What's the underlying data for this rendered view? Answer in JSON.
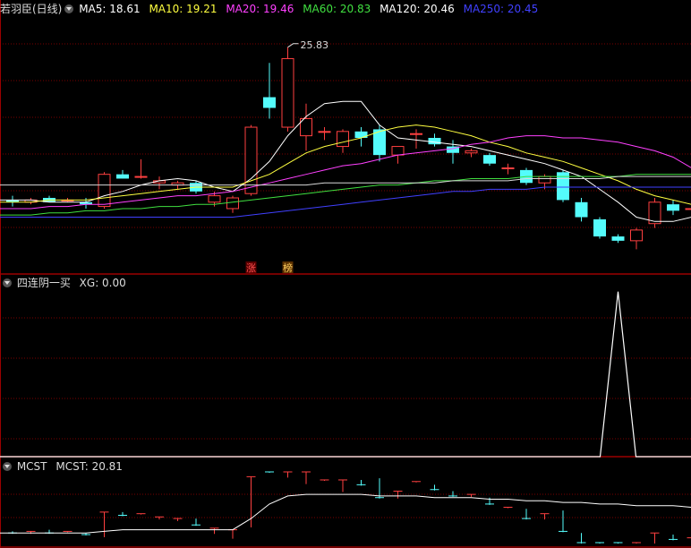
{
  "panel1": {
    "title": "若羽臣(日线)",
    "ma": [
      {
        "label": "MA5: 18.61",
        "color": "#ffffff"
      },
      {
        "label": "MA10: 19.21",
        "color": "#ffff40"
      },
      {
        "label": "MA20: 19.46",
        "color": "#ff40ff"
      },
      {
        "label": "MA60: 20.83",
        "color": "#40e040"
      },
      {
        "label": "MA120: 20.46",
        "color": "#ffffff"
      },
      {
        "label": "MA250: 20.45",
        "color": "#4040ff"
      }
    ],
    "peak_label": "25.83",
    "markers": [
      "涨",
      "榜"
    ]
  },
  "panel2": {
    "title": "四连阴一买",
    "legend": "XG: 0.00"
  },
  "panel3": {
    "title": "MCST",
    "legend": "MCST: 20.81"
  },
  "colors": {
    "up": "#ff4040",
    "down": "#54fcfc",
    "grid": "#7a0000",
    "border": "#9b0000"
  },
  "chart_data": {
    "type": "candlestick",
    "price_range": [
      16.0,
      27.2
    ],
    "candles": [
      {
        "o": 18.7,
        "h": 18.9,
        "l": 18.4,
        "c": 18.6
      },
      {
        "o": 18.6,
        "h": 18.8,
        "l": 18.5,
        "c": 18.7
      },
      {
        "o": 18.8,
        "h": 18.9,
        "l": 18.6,
        "c": 18.6
      },
      {
        "o": 18.7,
        "h": 18.8,
        "l": 18.6,
        "c": 18.7
      },
      {
        "o": 18.6,
        "h": 18.8,
        "l": 18.3,
        "c": 18.5
      },
      {
        "o": 18.4,
        "h": 20.0,
        "l": 18.3,
        "c": 19.9
      },
      {
        "o": 19.9,
        "h": 20.1,
        "l": 19.7,
        "c": 19.7
      },
      {
        "o": 19.8,
        "h": 20.6,
        "l": 19.7,
        "c": 19.8
      },
      {
        "o": 19.5,
        "h": 19.8,
        "l": 19.2,
        "c": 19.6
      },
      {
        "o": 19.4,
        "h": 19.6,
        "l": 19.2,
        "c": 19.5
      },
      {
        "o": 19.5,
        "h": 19.6,
        "l": 19.0,
        "c": 19.1
      },
      {
        "o": 18.6,
        "h": 19.1,
        "l": 18.4,
        "c": 18.9
      },
      {
        "o": 18.3,
        "h": 18.9,
        "l": 18.1,
        "c": 18.8
      },
      {
        "o": 19.0,
        "h": 22.2,
        "l": 18.9,
        "c": 22.1
      },
      {
        "o": 23.5,
        "h": 25.1,
        "l": 22.5,
        "c": 23.0
      },
      {
        "o": 22.1,
        "h": 25.83,
        "l": 21.9,
        "c": 25.3
      },
      {
        "o": 21.7,
        "h": 23.2,
        "l": 21.0,
        "c": 22.5
      },
      {
        "o": 21.9,
        "h": 22.1,
        "l": 21.5,
        "c": 21.9
      },
      {
        "o": 21.2,
        "h": 22.0,
        "l": 20.9,
        "c": 21.9
      },
      {
        "o": 21.9,
        "h": 22.1,
        "l": 21.2,
        "c": 21.6
      },
      {
        "o": 22.0,
        "h": 22.2,
        "l": 20.5,
        "c": 20.8
      },
      {
        "o": 20.8,
        "h": 21.2,
        "l": 20.4,
        "c": 21.2
      },
      {
        "o": 21.8,
        "h": 22.0,
        "l": 21.1,
        "c": 21.8
      },
      {
        "o": 21.6,
        "h": 21.8,
        "l": 21.2,
        "c": 21.3
      },
      {
        "o": 21.2,
        "h": 21.5,
        "l": 20.4,
        "c": 20.9
      },
      {
        "o": 20.9,
        "h": 21.1,
        "l": 20.7,
        "c": 21.0
      },
      {
        "o": 20.8,
        "h": 20.9,
        "l": 20.3,
        "c": 20.4
      },
      {
        "o": 20.2,
        "h": 20.4,
        "l": 19.9,
        "c": 20.2
      },
      {
        "o": 20.1,
        "h": 20.2,
        "l": 19.4,
        "c": 19.5
      },
      {
        "o": 19.5,
        "h": 19.9,
        "l": 19.2,
        "c": 19.8
      },
      {
        "o": 20.0,
        "h": 20.1,
        "l": 18.6,
        "c": 18.7
      },
      {
        "o": 18.6,
        "h": 18.8,
        "l": 17.7,
        "c": 17.9
      },
      {
        "o": 17.8,
        "h": 17.9,
        "l": 16.9,
        "c": 17.0
      },
      {
        "o": 17.0,
        "h": 17.1,
        "l": 16.7,
        "c": 16.8
      },
      {
        "o": 16.8,
        "h": 17.4,
        "l": 16.4,
        "c": 17.3
      },
      {
        "o": 17.6,
        "h": 18.8,
        "l": 17.4,
        "c": 18.6
      },
      {
        "o": 18.5,
        "h": 18.7,
        "l": 18.0,
        "c": 18.2
      },
      {
        "o": 18.3,
        "h": 18.5,
        "l": 18.1,
        "c": 18.3
      },
      {
        "o": 18.4,
        "h": 18.8,
        "l": 18.2,
        "c": 18.7
      }
    ],
    "ma_series": [
      {
        "label_index": 0,
        "color": "#ffffff",
        "values": [
          18.7,
          18.7,
          18.6,
          18.6,
          18.6,
          18.9,
          19.1,
          19.4,
          19.6,
          19.7,
          19.6,
          19.3,
          19.1,
          19.7,
          20.5,
          21.7,
          22.6,
          23.2,
          23.3,
          23.3,
          22.2,
          21.6,
          21.5,
          21.4,
          21.3,
          21.2,
          21.0,
          20.8,
          20.6,
          20.4,
          20.1,
          19.8,
          19.2,
          18.6,
          17.9,
          17.7,
          17.7,
          17.9,
          18.4
        ]
      },
      {
        "label_index": 1,
        "color": "#ffff40",
        "values": [
          18.6,
          18.6,
          18.7,
          18.7,
          18.7,
          18.8,
          18.9,
          19.0,
          19.1,
          19.2,
          19.3,
          19.3,
          19.3,
          19.6,
          19.9,
          20.4,
          20.9,
          21.2,
          21.4,
          21.6,
          21.9,
          22.1,
          22.2,
          22.1,
          21.9,
          21.7,
          21.4,
          21.2,
          20.9,
          20.7,
          20.5,
          20.2,
          19.9,
          19.6,
          19.2,
          18.9,
          18.7,
          18.5,
          18.4
        ]
      },
      {
        "label_index": 2,
        "color": "#ff40ff",
        "values": [
          18.3,
          18.3,
          18.4,
          18.4,
          18.5,
          18.5,
          18.6,
          18.7,
          18.8,
          18.9,
          18.9,
          19.0,
          19.1,
          19.3,
          19.5,
          19.7,
          19.9,
          20.1,
          20.3,
          20.4,
          20.6,
          20.8,
          20.9,
          21.0,
          21.1,
          21.3,
          21.4,
          21.6,
          21.7,
          21.7,
          21.6,
          21.6,
          21.5,
          21.4,
          21.2,
          21.0,
          20.7,
          20.2,
          19.5
        ]
      },
      {
        "label_index": 3,
        "color": "#40e040",
        "values": [
          18.0,
          18.0,
          18.1,
          18.1,
          18.2,
          18.2,
          18.3,
          18.3,
          18.4,
          18.4,
          18.5,
          18.5,
          18.6,
          18.7,
          18.8,
          18.9,
          19.0,
          19.1,
          19.2,
          19.3,
          19.4,
          19.4,
          19.5,
          19.6,
          19.6,
          19.7,
          19.7,
          19.7,
          19.8,
          19.8,
          19.8,
          19.8,
          19.8,
          19.8,
          19.9,
          19.9,
          19.9,
          19.9,
          19.9
        ]
      },
      {
        "label_index": 4,
        "color": "#d8d8d8",
        "values": [
          19.4,
          19.4,
          19.4,
          19.4,
          19.4,
          19.4,
          19.4,
          19.4,
          19.4,
          19.4,
          19.4,
          19.4,
          19.4,
          19.4,
          19.4,
          19.4,
          19.4,
          19.5,
          19.5,
          19.5,
          19.5,
          19.5,
          19.5,
          19.5,
          19.6,
          19.6,
          19.6,
          19.6,
          19.7,
          19.7,
          19.7,
          19.7,
          19.7,
          19.8,
          19.8,
          19.8,
          19.8,
          19.8,
          19.8
        ]
      },
      {
        "label_index": 5,
        "color": "#4040ff",
        "values": [
          17.9,
          17.9,
          17.9,
          17.9,
          17.9,
          17.9,
          17.9,
          17.9,
          17.9,
          17.9,
          17.9,
          17.9,
          17.9,
          18.0,
          18.1,
          18.2,
          18.3,
          18.4,
          18.5,
          18.6,
          18.7,
          18.8,
          18.9,
          19.0,
          19.1,
          19.1,
          19.2,
          19.2,
          19.2,
          19.3,
          19.3,
          19.3,
          19.3,
          19.3,
          19.3,
          19.3,
          19.3,
          19.3,
          19.3
        ]
      }
    ],
    "xg": {
      "values": [
        0,
        0,
        0,
        0,
        0,
        0,
        0,
        0,
        0,
        0,
        0,
        0,
        0,
        0,
        0,
        0,
        0,
        0,
        0,
        0,
        0,
        0,
        0,
        0,
        0,
        0,
        0,
        0,
        0,
        0,
        0,
        0,
        0,
        1,
        0,
        0,
        0,
        0,
        0
      ],
      "range": [
        0,
        1.02
      ]
    },
    "mcst": {
      "values": [
        18.6,
        18.6,
        18.6,
        18.6,
        18.6,
        18.7,
        18.8,
        18.8,
        18.8,
        18.8,
        18.8,
        18.8,
        18.8,
        19.5,
        20.4,
        20.9,
        21.0,
        21.0,
        21.0,
        21.0,
        20.9,
        20.9,
        20.9,
        20.8,
        20.8,
        20.8,
        20.7,
        20.7,
        20.6,
        20.6,
        20.5,
        20.5,
        20.4,
        20.4,
        20.3,
        20.3,
        20.3,
        20.2,
        20.2
      ],
      "range": [
        18.0,
        22.4
      ]
    }
  }
}
